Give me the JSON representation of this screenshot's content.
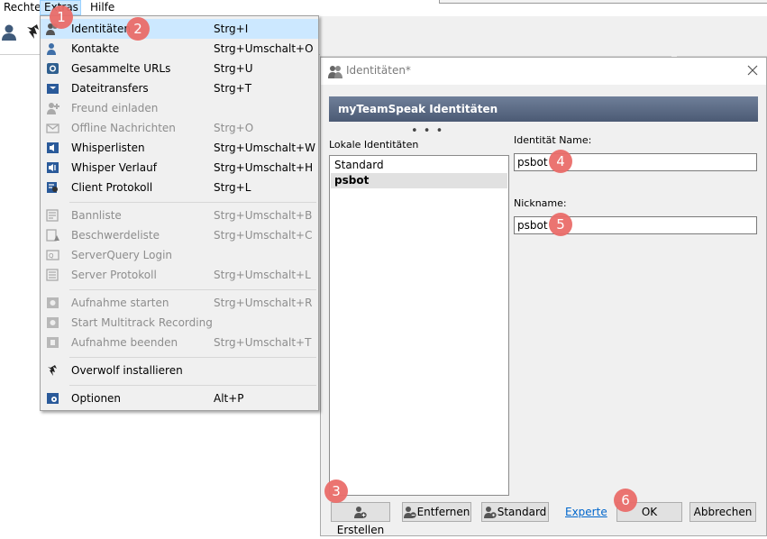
{
  "menubar": {
    "items": [
      "Rechte",
      "Extras",
      "Hilfe"
    ]
  },
  "extras_menu": {
    "items": [
      {
        "label": "Identitäten",
        "shortcut": "Strg+I",
        "icon": "identities-icon",
        "disabled": false
      },
      {
        "label": "Kontakte",
        "shortcut": "Strg+Umschalt+O",
        "icon": "contacts-icon",
        "disabled": false
      },
      {
        "label": "Gesammelte URLs",
        "shortcut": "Strg+U",
        "icon": "url-catcher-icon",
        "disabled": false
      },
      {
        "label": "Dateitransfers",
        "shortcut": "Strg+T",
        "icon": "file-transfer-icon",
        "disabled": false
      },
      {
        "label": "Freund einladen",
        "shortcut": "",
        "icon": "invite-friend-icon",
        "disabled": true
      },
      {
        "label": "Offline Nachrichten",
        "shortcut": "Strg+O",
        "icon": "offline-messages-icon",
        "disabled": true
      },
      {
        "label": "Whisperlisten",
        "shortcut": "Strg+Umschalt+W",
        "icon": "whisper-lists-icon",
        "disabled": false
      },
      {
        "label": "Whisper Verlauf",
        "shortcut": "Strg+Umschalt+H",
        "icon": "whisper-history-icon",
        "disabled": false
      },
      {
        "label": "Client Protokoll",
        "shortcut": "Strg+L",
        "icon": "client-log-icon",
        "disabled": false
      },
      {
        "label": "Bannliste",
        "shortcut": "Strg+Umschalt+B",
        "icon": "ban-list-icon",
        "disabled": true
      },
      {
        "label": "Beschwerdeliste",
        "shortcut": "Strg+Umschalt+C",
        "icon": "complaint-list-icon",
        "disabled": true
      },
      {
        "label": "ServerQuery Login",
        "shortcut": "",
        "icon": "serverquery-login-icon",
        "disabled": true
      },
      {
        "label": "Server Protokoll",
        "shortcut": "Strg+Umschalt+L",
        "icon": "server-log-icon",
        "disabled": true
      },
      {
        "label": "Aufnahme starten",
        "shortcut": "Strg+Umschalt+R",
        "icon": "record-start-icon",
        "disabled": true
      },
      {
        "label": "Start Multitrack Recording",
        "shortcut": "",
        "icon": "multitrack-record-icon",
        "disabled": true
      },
      {
        "label": "Aufnahme beenden",
        "shortcut": "Strg+Umschalt+T",
        "icon": "record-stop-icon",
        "disabled": true
      },
      {
        "label": "Overwolf installieren",
        "shortcut": "",
        "icon": "overwolf-icon",
        "disabled": false
      },
      {
        "label": "Optionen",
        "shortcut": "Alt+P",
        "icon": "options-icon",
        "disabled": false
      }
    ]
  },
  "dialog": {
    "title": "Identitäten*",
    "header": "myTeamSpeak Identitäten",
    "local_label": "Lokale Identitäten",
    "list": [
      "Standard",
      "psbot"
    ],
    "selected": "psbot",
    "name_label": "Identität Name:",
    "name_value": "psbot",
    "nickname_label": "Nickname:",
    "nickname_value": "psbot",
    "buttons": {
      "create": "Erstellen",
      "remove": "Entfernen",
      "default": "Standard",
      "expert": "Experte",
      "ok": "OK",
      "cancel": "Abbrechen"
    }
  },
  "callouts": [
    "1",
    "2",
    "3",
    "4",
    "5",
    "6"
  ],
  "colors": {
    "menu_highlight": "#cce8ff",
    "banner": "#5a6985",
    "callout": "#ea6d6a",
    "link": "#0066cc"
  }
}
